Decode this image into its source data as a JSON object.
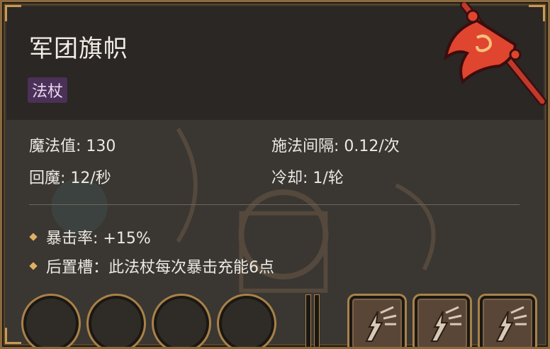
{
  "item": {
    "name": "军团旗帜",
    "type": "法杖",
    "icon": "flag-staff-icon"
  },
  "stats": {
    "mana": "魔法值: 130",
    "cast_interval": "施法间隔: 0.12/次",
    "regen": "回魔: 12/秒",
    "cooldown": "冷却: 1/轮"
  },
  "bonuses": [
    "暴击率: +15%",
    "后置槽：此法杖每次暴击充能6点"
  ],
  "slots": {
    "empty_count": 4,
    "spell_icon": "lightning-hand-icon",
    "spell_count": 3
  },
  "colors": {
    "badge": "#4b3058",
    "frame": "#a98248",
    "text": "#ece8e2"
  }
}
